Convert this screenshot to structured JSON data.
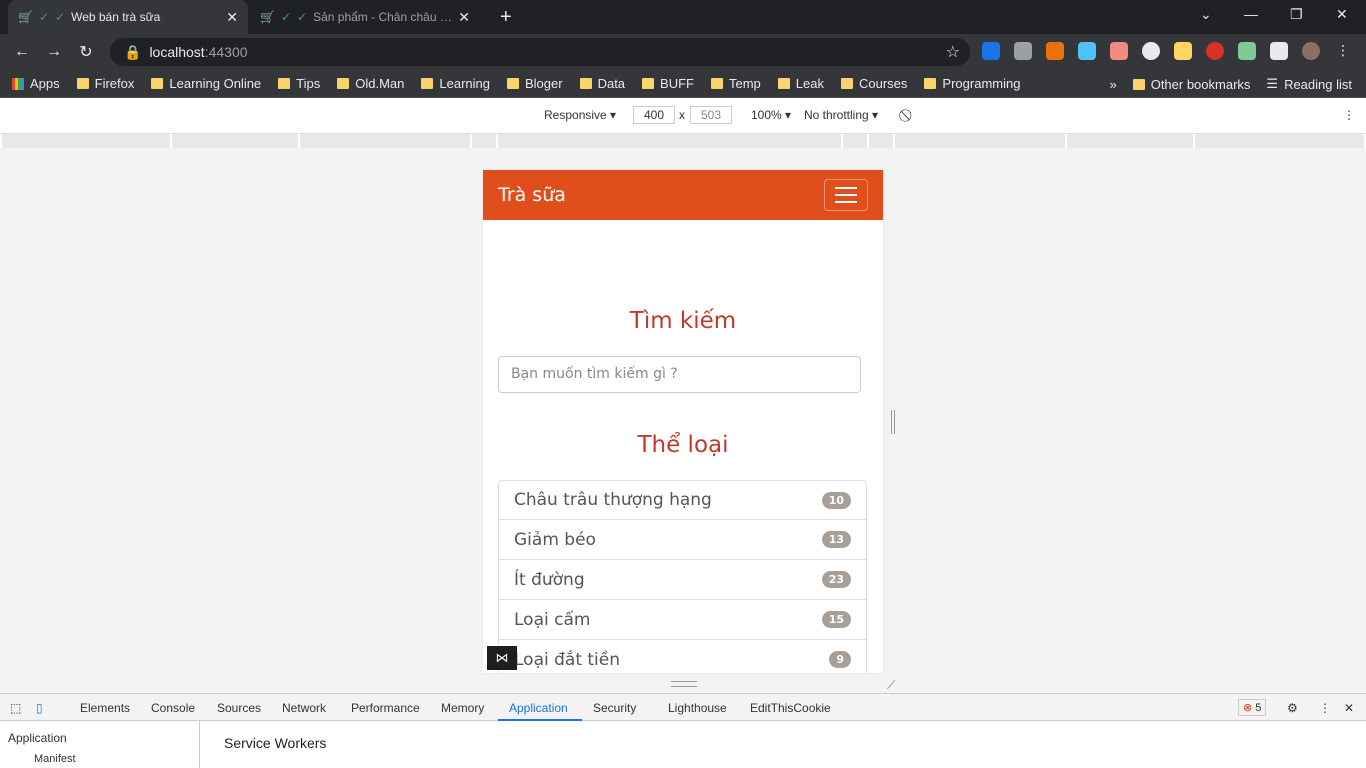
{
  "browser": {
    "tabs": [
      {
        "title": "Web bán trà sữa",
        "active": true
      },
      {
        "title": "Sản phẩm - Chân châu nướng",
        "active": false
      }
    ],
    "url_host": "localhost",
    "url_port": ":44300",
    "bookmarks": [
      "Apps",
      "Firefox",
      "Learning Online",
      "Tips",
      "Old.Man",
      "Learning",
      "Bloger",
      "Data",
      "BUFF",
      "Temp",
      "Leak",
      "Courses",
      "Programming"
    ],
    "bookmarks_more": "»",
    "other_bookmarks": "Other bookmarks",
    "reading_list": "Reading list"
  },
  "device_toolbar": {
    "mode": "Responsive",
    "width": "400",
    "height": "503",
    "times": "x",
    "zoom": "100%",
    "throttling": "No throttling"
  },
  "site": {
    "brand": "Trà sữa",
    "search_title": "Tìm kiếm",
    "search_placeholder": "Bạn muốn tìm kiếm gì ?",
    "category_title": "Thể loại",
    "categories": [
      {
        "name": "Châu trâu thượng hạng",
        "count": "10"
      },
      {
        "name": "Giảm béo",
        "count": "13"
      },
      {
        "name": "Ít đường",
        "count": "23"
      },
      {
        "name": "Loại cấm",
        "count": "15"
      },
      {
        "name": "Loại đắt tiền",
        "count": "9"
      }
    ],
    "colors": {
      "navbar": "#e04e1b",
      "title": "#c0392b"
    }
  },
  "devtools": {
    "tabs": [
      "Elements",
      "Console",
      "Sources",
      "Network",
      "Performance",
      "Memory",
      "Application",
      "Security",
      "Lighthouse",
      "EditThisCookie"
    ],
    "active_tab": "Application",
    "error_count": "5",
    "sidebar_heading": "Application",
    "sidebar_item": "Manifest",
    "main_heading": "Service Workers"
  }
}
